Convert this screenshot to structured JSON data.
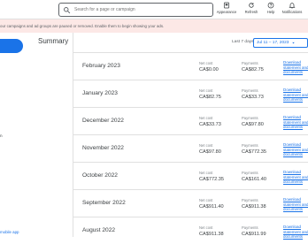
{
  "header": {
    "search_placeholder": "Search for a page or campaign",
    "buttons": [
      {
        "label": "Appearance",
        "icon": "appearance-icon"
      },
      {
        "label": "Refresh",
        "icon": "refresh-icon"
      },
      {
        "label": "Help",
        "icon": "help-icon"
      },
      {
        "label": "Notifications",
        "icon": "bell-icon"
      }
    ]
  },
  "banner": {
    "text": "our campaigns and ad groups are paused or removed. Enable them to begin showing your ads."
  },
  "sidebar": {
    "items": [
      {
        "label": "n"
      }
    ],
    "bottom_link": "mobile app"
  },
  "summary": {
    "title": "Summary",
    "date_range_label": "Last 7 days",
    "date_range_value": "Jul 11 – 17, 2023"
  },
  "rows": [
    {
      "month": "February 2023",
      "net_cost_label": "Net cost",
      "net_cost": "CA$0.00",
      "payments_label": "Payments",
      "payments": "CA$82.75",
      "doc_link": "Download statement and documents"
    },
    {
      "month": "January 2023",
      "net_cost_label": "Net cost",
      "net_cost": "CA$82.75",
      "payments_label": "Payments",
      "payments": "CA$33.73",
      "doc_link": "Download statement and documents"
    },
    {
      "month": "December 2022",
      "net_cost_label": "Net cost",
      "net_cost": "CA$33.73",
      "payments_label": "Payments",
      "payments": "CA$97.80",
      "doc_link": "Download statement and documents"
    },
    {
      "month": "November 2022",
      "net_cost_label": "Net cost",
      "net_cost": "CA$97.80",
      "payments_label": "Payments",
      "payments": "CA$772.35",
      "doc_link": "Download statement and documents"
    },
    {
      "month": "October 2022",
      "net_cost_label": "Net cost",
      "net_cost": "CA$772.35",
      "payments_label": "Payments",
      "payments": "CA$161.40",
      "doc_link": "Download statement and documents"
    },
    {
      "month": "September 2022",
      "net_cost_label": "Net cost",
      "net_cost": "CA$911.40",
      "payments_label": "Payments",
      "payments": "CA$911.38",
      "doc_link": "Download statement and documents"
    },
    {
      "month": "August 2022",
      "net_cost_label": "Net cost",
      "net_cost": "CA$911.38",
      "payments_label": "Payments",
      "payments": "CA$911.99",
      "doc_link": "Download statement and documents"
    }
  ],
  "colors": {
    "accent": "#1a73e8",
    "banner_bg": "#fce8e6"
  }
}
